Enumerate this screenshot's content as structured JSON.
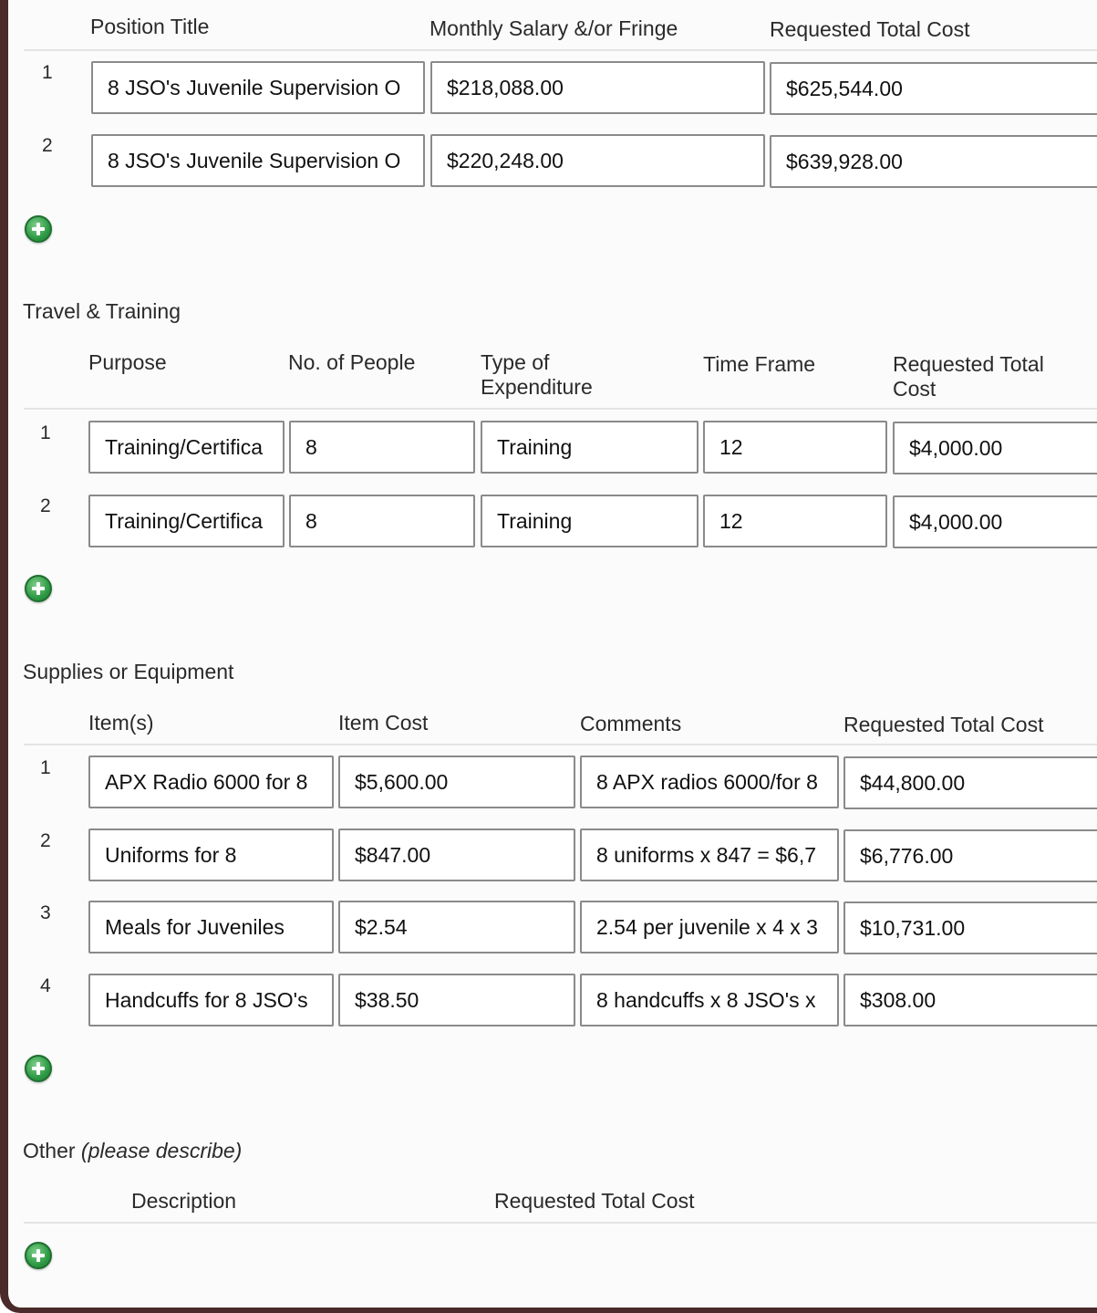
{
  "personnel": {
    "headers": [
      "Position Title",
      "Monthly Salary &/or Fringe",
      "Requested Total Cost"
    ],
    "rows": [
      {
        "num": "1",
        "cells": [
          "8 JSO's Juvenile Supervision O",
          "$218,088.00",
          "$625,544.00"
        ]
      },
      {
        "num": "2",
        "cells": [
          "8 JSO's Juvenile Supervision O",
          "$220,248.00",
          "$639,928.00"
        ]
      }
    ]
  },
  "travel": {
    "title": "Travel & Training",
    "headers": [
      "Purpose",
      "No. of People",
      "Type of",
      "Expenditure",
      "Time Frame",
      "Requested Total",
      "Cost"
    ],
    "rows": [
      {
        "num": "1",
        "cells": [
          "Training/Certifica",
          "8",
          "Training",
          "12",
          "$4,000.00"
        ]
      },
      {
        "num": "2",
        "cells": [
          "Training/Certifica",
          "8",
          "Training",
          "12",
          "$4,000.00"
        ]
      }
    ]
  },
  "supplies": {
    "title": "Supplies or Equipment",
    "headers": [
      "Item(s)",
      "Item Cost",
      "Comments",
      "Requested Total Cost"
    ],
    "rows": [
      {
        "num": "1",
        "cells": [
          "APX Radio 6000 for 8",
          "$5,600.00",
          "8 APX radios 6000/for 8",
          "$44,800.00"
        ]
      },
      {
        "num": "2",
        "cells": [
          "Uniforms for 8",
          "$847.00",
          "8 uniforms x 847 = $6,7",
          "$6,776.00"
        ]
      },
      {
        "num": "3",
        "cells": [
          "Meals for Juveniles",
          "$2.54",
          "2.54 per juvenile x 4 x 3",
          "$10,731.00"
        ]
      },
      {
        "num": "4",
        "cells": [
          "Handcuffs for 8 JSO's",
          "$38.50",
          "8 handcuffs x 8 JSO's x",
          "$308.00"
        ]
      }
    ]
  },
  "other": {
    "title": "Other",
    "title_note": "(please describe)",
    "headers": [
      "Description",
      "Requested Total Cost"
    ]
  },
  "icons": {
    "add": "add-row-icon"
  },
  "colors": {
    "add_button": "#2f9a45",
    "frame_border": "#4a2a2a",
    "field_border": "#8a8a8a"
  }
}
